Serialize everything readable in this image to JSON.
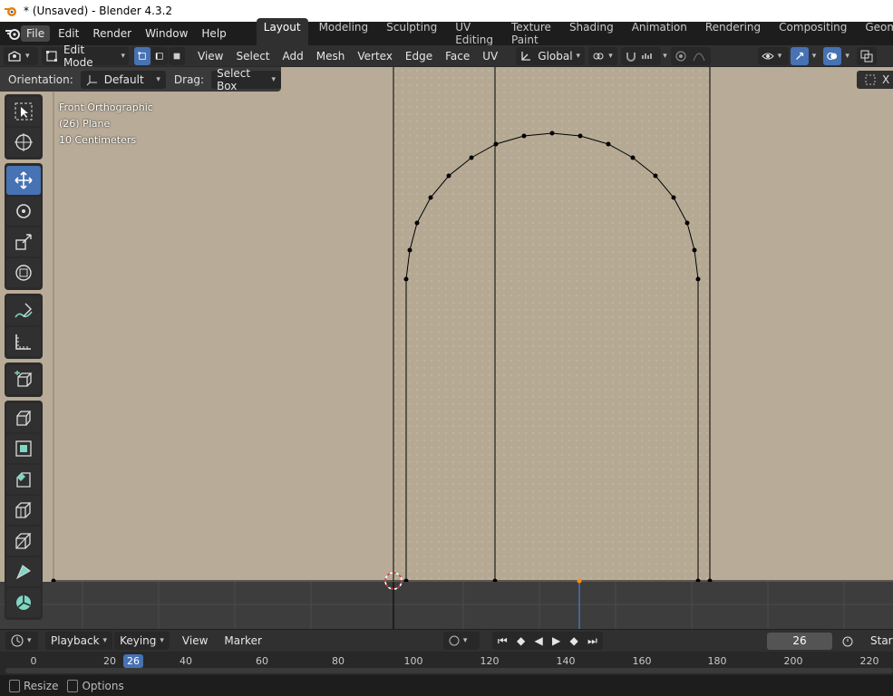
{
  "window": {
    "title": "* (Unsaved) - Blender 4.3.2"
  },
  "menubar": {
    "menus": [
      "File",
      "Edit",
      "Render",
      "Window",
      "Help"
    ],
    "active_menu": "File",
    "workspaces": [
      "Layout",
      "Modeling",
      "Sculpting",
      "UV Editing",
      "Texture Paint",
      "Shading",
      "Animation",
      "Rendering",
      "Compositing",
      "Geometr"
    ],
    "active_workspace": "Layout"
  },
  "header3d": {
    "mode": "Edit Mode",
    "menus": [
      "View",
      "Select",
      "Add",
      "Mesh",
      "Vertex",
      "Edge",
      "Face",
      "UV"
    ],
    "transform_orientation": "Global"
  },
  "tool_settings": {
    "orientation_label": "Orientation:",
    "orientation_value": "Default",
    "drag_label": "Drag:",
    "drag_value": "Select Box"
  },
  "viewport": {
    "view_name": "Front Orthographic",
    "object_name": "(26) Plane",
    "grid_scale": "10 Centimeters",
    "background_color": "#b8ab97"
  },
  "toolbar_icons": [
    "select-box-icon",
    "cursor-icon",
    "move-icon",
    "rotate-icon",
    "scale-icon",
    "transform-icon",
    "annotate-icon",
    "measure-icon",
    "add-cube-icon",
    "extrude-icon",
    "inset-icon",
    "bevel-icon",
    "loop-cut-icon",
    "knife-icon",
    "poly-build-icon",
    "spin-icon"
  ],
  "timeline": {
    "playback_label": "Playback",
    "keying_label": "Keying",
    "view_label": "View",
    "marker_label": "Marker",
    "current_frame": "26",
    "start_label": "Start",
    "ticks": [
      "0",
      "20",
      "40",
      "60",
      "80",
      "100",
      "120",
      "140",
      "160",
      "180",
      "200",
      "220"
    ]
  },
  "statusbar": {
    "items": [
      "Resize",
      "Options"
    ]
  },
  "colors": {
    "accent": "#4772b3",
    "edge": "#000000",
    "cursor_red": "#d93a3a"
  }
}
